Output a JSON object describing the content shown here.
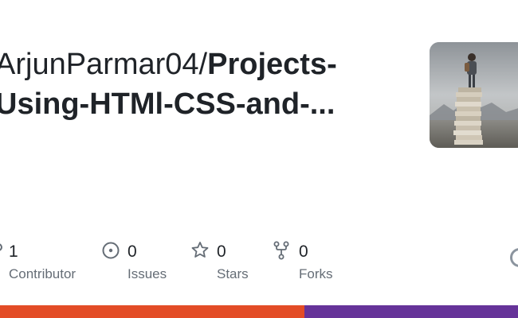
{
  "repo": {
    "owner": "ArjunParmar04/",
    "name_line1": "Projects-",
    "name_line2": "Using-HTMl-CSS-and-..."
  },
  "thumbnail": {
    "icon": "person-on-book-stack-image"
  },
  "stats": [
    {
      "icon": "people-icon",
      "value": "1",
      "label": "Contributor"
    },
    {
      "icon": "issue-icon",
      "value": "0",
      "label": "Issues"
    },
    {
      "icon": "star-icon",
      "value": "0",
      "label": "Stars"
    },
    {
      "icon": "fork-icon",
      "value": "0",
      "label": "Forks"
    }
  ],
  "language_bar": [
    {
      "color": "#e34c26",
      "fraction": 0.587
    },
    {
      "color": "#663399",
      "fraction": 0.413
    }
  ]
}
